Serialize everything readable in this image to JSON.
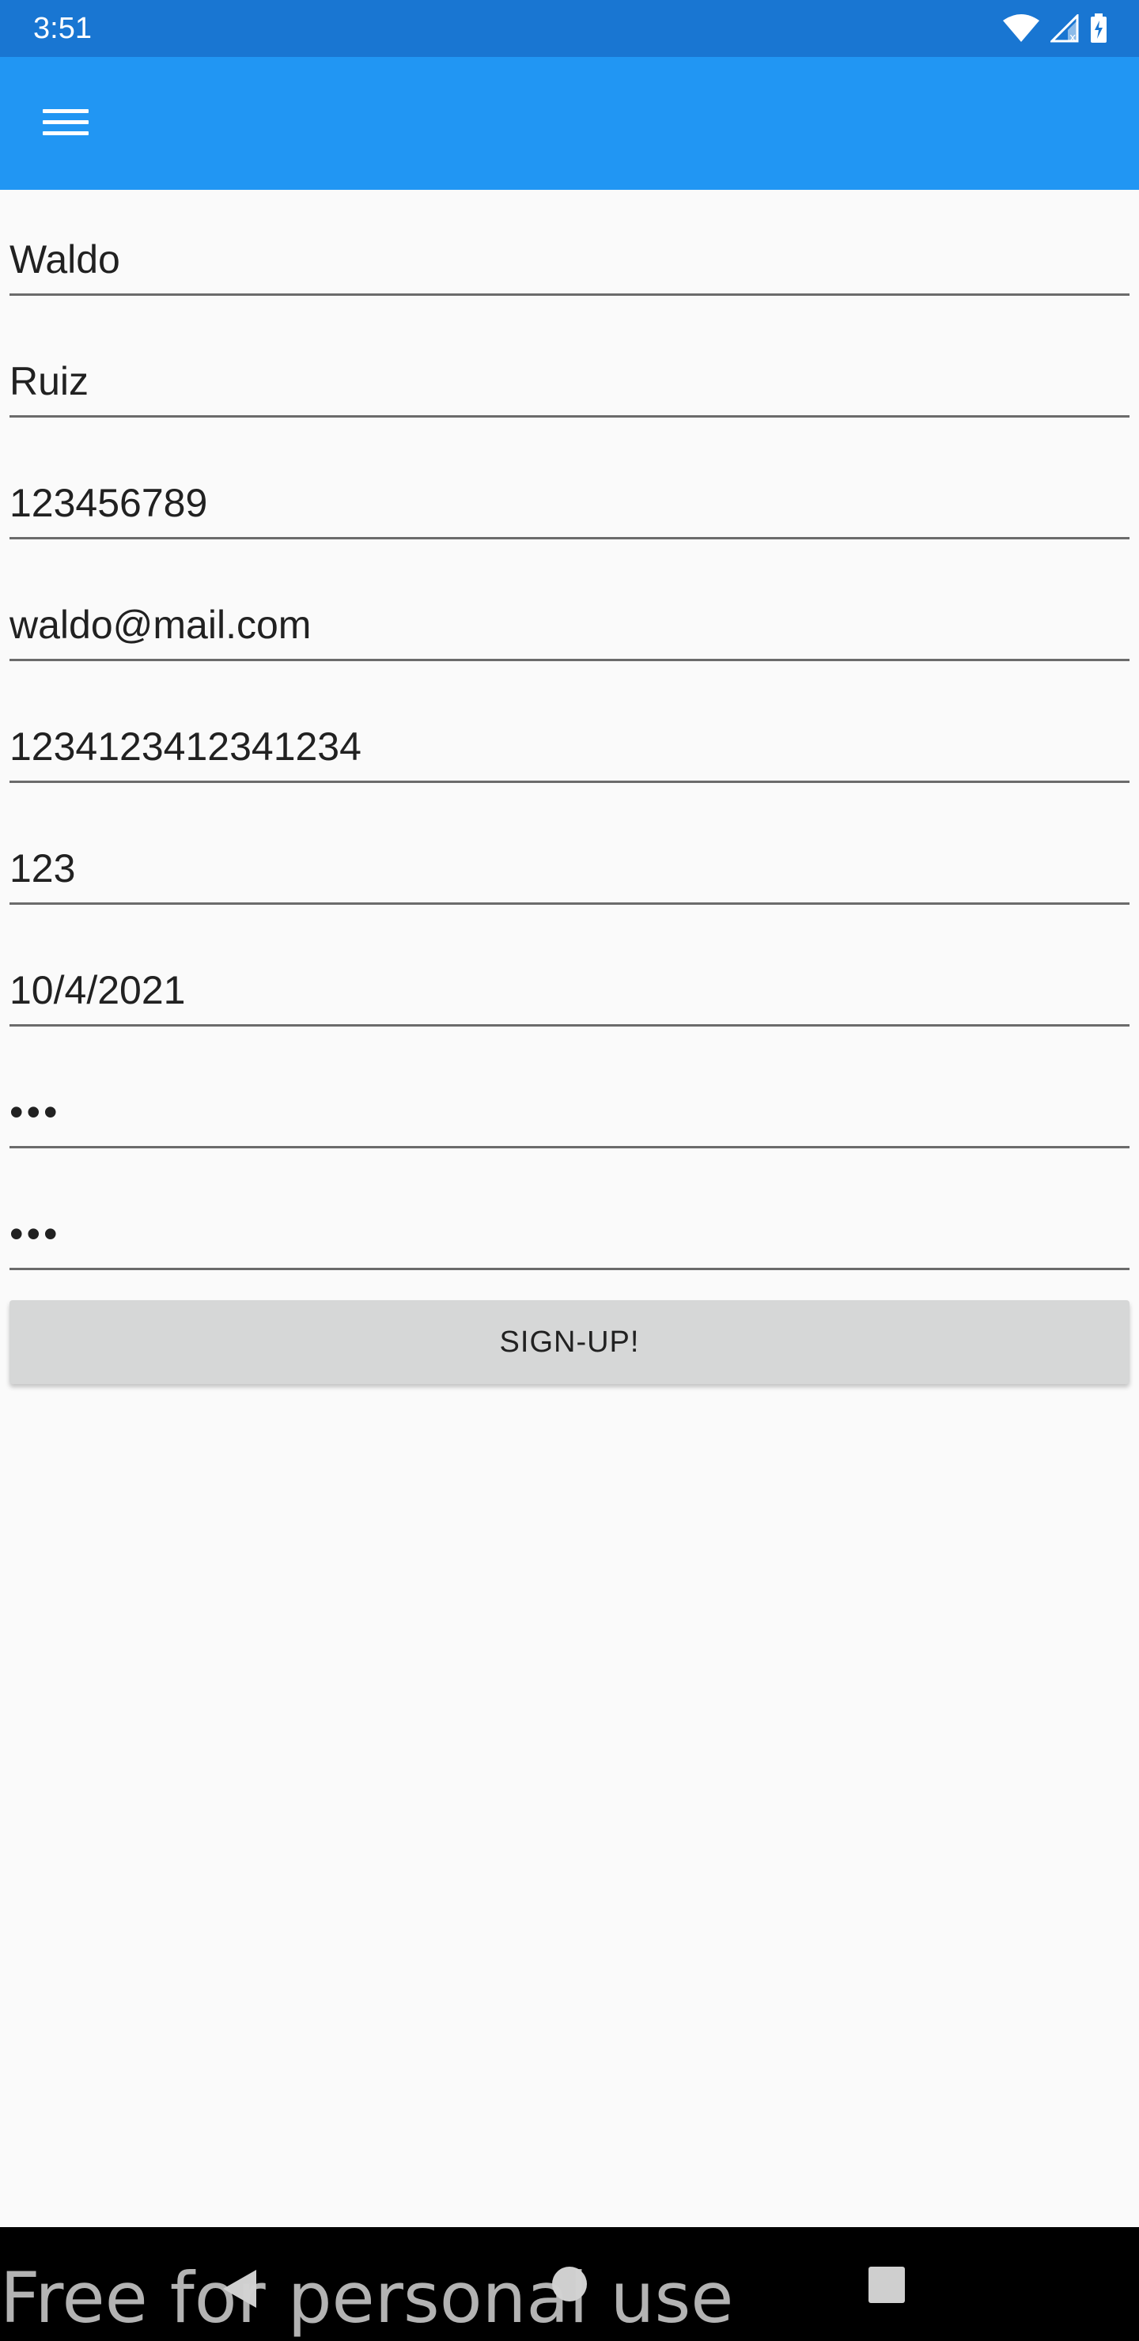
{
  "status_bar": {
    "time": "3:51",
    "icons": [
      "wifi-icon",
      "signal-icon",
      "battery-charging-icon"
    ]
  },
  "app_bar": {
    "menu_icon": "menu-icon",
    "color": "#2196f3",
    "status_color": "#1976d2"
  },
  "form": {
    "fields": [
      {
        "value": "Waldo"
      },
      {
        "value": "Ruiz"
      },
      {
        "value": "123456789"
      },
      {
        "value": "waldo@mail.com"
      },
      {
        "value": "1234123412341234"
      },
      {
        "value": "123"
      },
      {
        "value": "10/4/2021"
      },
      {
        "value": "•••"
      },
      {
        "value": "•••"
      }
    ],
    "signup_label": "SIGN-UP!"
  },
  "watermark": "Free for personal use",
  "nav_bar": {
    "icons": [
      "back-icon",
      "home-icon",
      "recents-icon"
    ]
  }
}
